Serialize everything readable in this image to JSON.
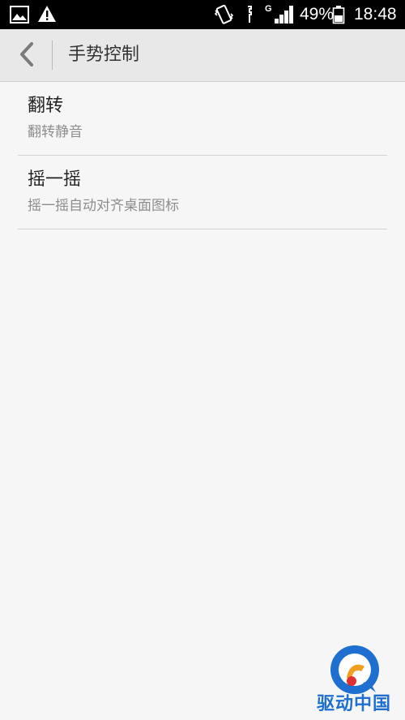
{
  "status_bar": {
    "battery_percent": "49%",
    "time": "18:48",
    "network_type": "G",
    "icons": [
      "image-icon",
      "warning-icon",
      "vibrate-icon",
      "nfc-icon",
      "signal-icon",
      "battery-icon"
    ]
  },
  "action_bar": {
    "title": "手势控制",
    "back_icon": "chevron-left-icon"
  },
  "settings": {
    "items": [
      {
        "title": "翻转",
        "subtitle": "翻转静音"
      },
      {
        "title": "摇一摇",
        "subtitle": "摇一摇自动对齐桌面图标"
      }
    ]
  },
  "watermark": {
    "text": "驱动中国",
    "color": "#1e6fd0"
  },
  "colors": {
    "background": "#f6f6f6",
    "action_bar": "#e8e8e8",
    "status_bar": "#000000",
    "divider": "#d3d3d3"
  }
}
